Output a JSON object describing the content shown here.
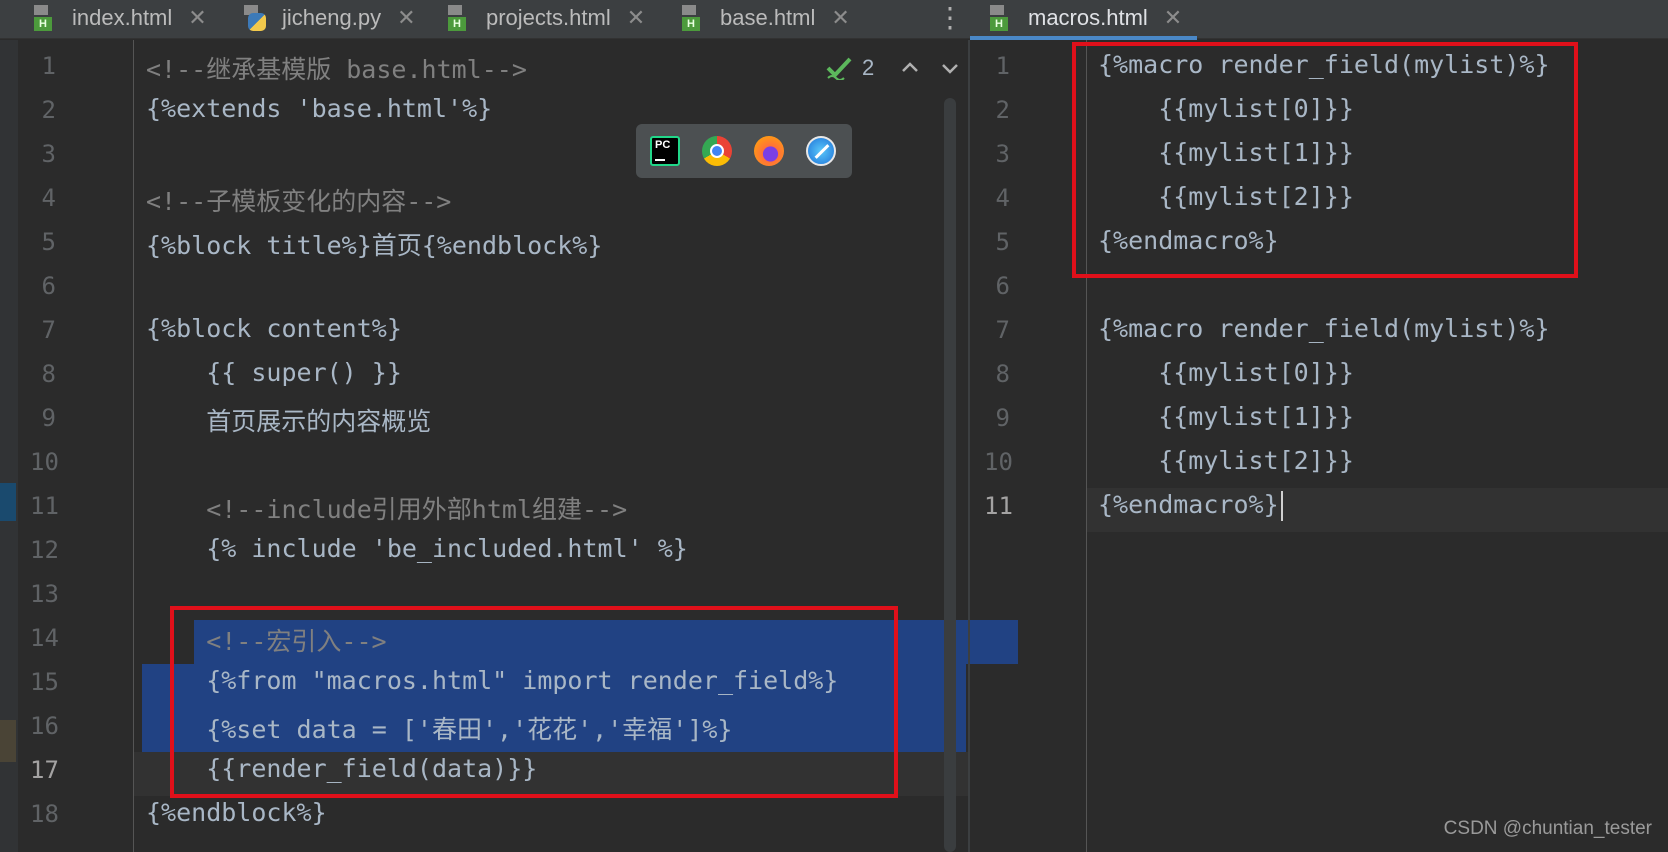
{
  "tabs": {
    "left": [
      {
        "label": "index.html",
        "icon": "html-file-icon"
      },
      {
        "label": "jicheng.py",
        "icon": "python-file-icon"
      },
      {
        "label": "projects.html",
        "icon": "html-file-icon"
      },
      {
        "label": "base.html",
        "icon": "html-file-icon"
      }
    ],
    "right": [
      {
        "label": "macros.html",
        "icon": "html-file-icon"
      }
    ],
    "close_glyph": "✕"
  },
  "inspection": {
    "count": "2"
  },
  "left_editor": {
    "lines": [
      {
        "n": "1",
        "text": "<!--继承基模版 base.html-->",
        "type": "comment"
      },
      {
        "n": "2",
        "text": "{%extends 'base.html'%}",
        "type": "code"
      },
      {
        "n": "3",
        "text": "",
        "type": "code"
      },
      {
        "n": "4",
        "text": "<!--子模板变化的内容-->",
        "type": "comment"
      },
      {
        "n": "5",
        "text": "{%block title%}首页{%endblock%}",
        "type": "code"
      },
      {
        "n": "6",
        "text": "",
        "type": "code"
      },
      {
        "n": "7",
        "text": "{%block content%}",
        "type": "code"
      },
      {
        "n": "8",
        "text": "    {{ super() }}",
        "type": "code"
      },
      {
        "n": "9",
        "text": "    首页展示的内容概览",
        "type": "code"
      },
      {
        "n": "10",
        "text": "",
        "type": "code"
      },
      {
        "n": "11",
        "text": "    <!--include引用外部html组建-->",
        "type": "comment"
      },
      {
        "n": "12",
        "text": "    {% include 'be_included.html' %}",
        "type": "code"
      },
      {
        "n": "13",
        "text": "",
        "type": "code"
      },
      {
        "n": "14",
        "text": "    <!--宏引入-->",
        "type": "comment"
      },
      {
        "n": "15",
        "text": "    {%from \"macros.html\" import render_field%}",
        "type": "code"
      },
      {
        "n": "16",
        "text": "    {%set data = ['春田','花花','幸福']%}",
        "type": "code"
      },
      {
        "n": "17",
        "text": "    {{render_field(data)}}",
        "type": "code"
      },
      {
        "n": "18",
        "text": "{%endblock%}",
        "type": "code"
      }
    ]
  },
  "right_editor": {
    "lines": [
      {
        "n": "1",
        "text": "{%macro render_field(mylist)%}"
      },
      {
        "n": "2",
        "text": "    {{mylist[0]}}"
      },
      {
        "n": "3",
        "text": "    {{mylist[1]}}"
      },
      {
        "n": "4",
        "text": "    {{mylist[2]}}"
      },
      {
        "n": "5",
        "text": "{%endmacro%}"
      },
      {
        "n": "6",
        "text": ""
      },
      {
        "n": "7",
        "text": "{%macro render_field(mylist)%}"
      },
      {
        "n": "8",
        "text": "    {{mylist[0]}}"
      },
      {
        "n": "9",
        "text": "    {{mylist[1]}}"
      },
      {
        "n": "10",
        "text": "    {{mylist[2]}}"
      },
      {
        "n": "11",
        "text": "{%endmacro%}"
      }
    ]
  },
  "browser_popup": [
    {
      "name": "pycharm-icon",
      "color": "#21d789"
    },
    {
      "name": "chrome-icon",
      "color": "#4285f4"
    },
    {
      "name": "firefox-icon",
      "color": "#ff7139"
    },
    {
      "name": "safari-icon",
      "color": "#1e90ff"
    }
  ],
  "watermark": "CSDN @chuntian_tester",
  "colors": {
    "selection": "#214283",
    "annotation_box": "#e0101a",
    "editor_bg": "#2b2b2b"
  }
}
